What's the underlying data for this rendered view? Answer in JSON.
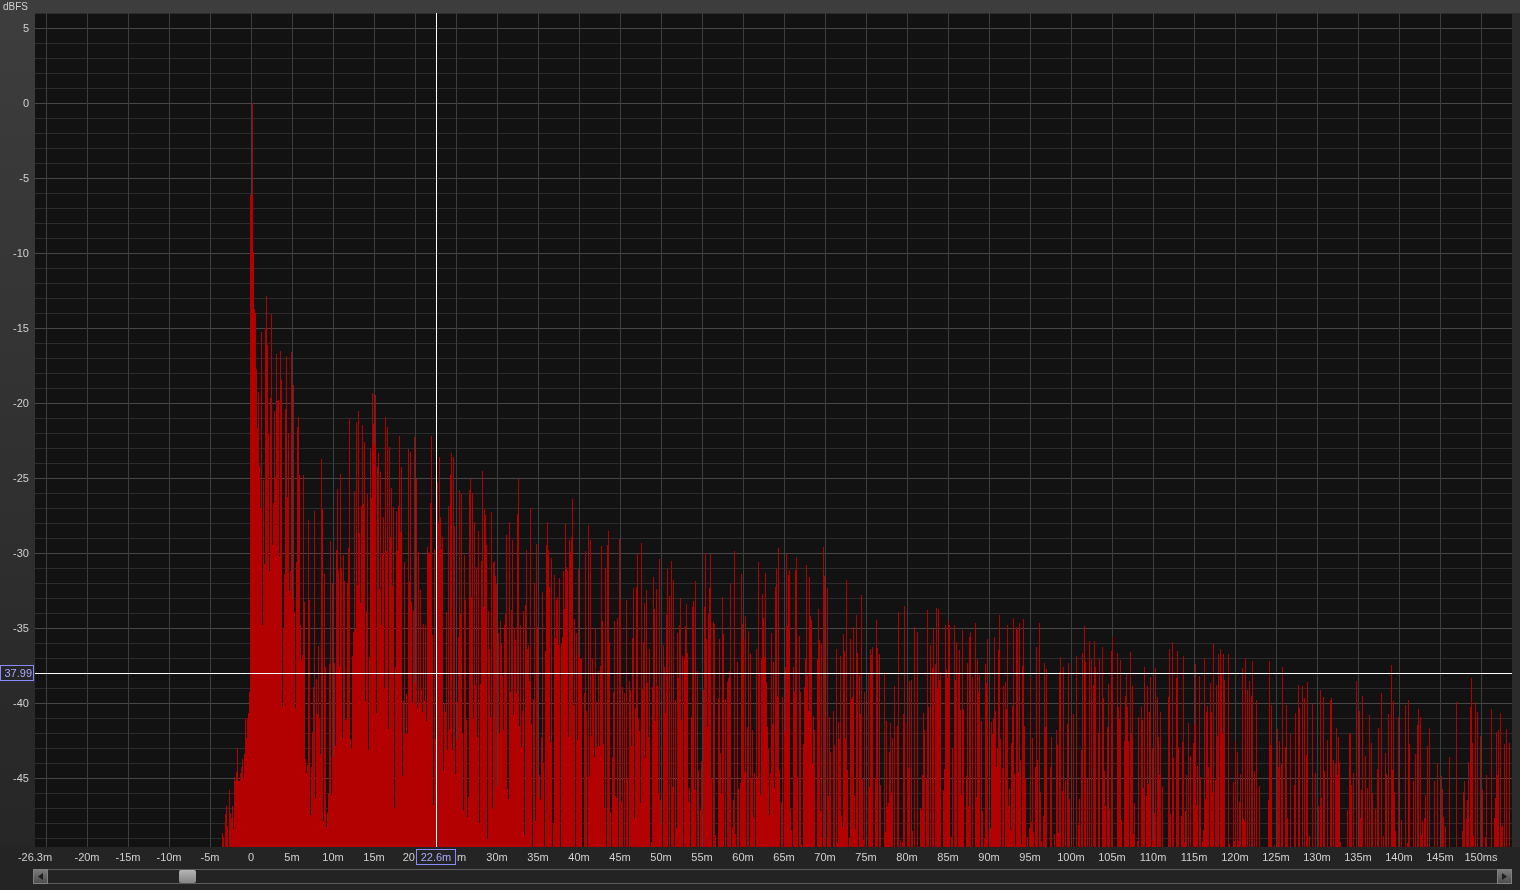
{
  "y_axis": {
    "unit": "dBFS",
    "ticks": [
      "5",
      "0",
      "-5",
      "-10",
      "-15",
      "-20",
      "-25",
      "-30",
      "-35",
      "-40",
      "-45"
    ]
  },
  "x_axis": {
    "ticks": [
      "-26.3m",
      "-20m",
      "-15m",
      "-10m",
      "-5m",
      "0",
      "5m",
      "10m",
      "15m",
      "20",
      "m",
      "30m",
      "35m",
      "40m",
      "45m",
      "50m",
      "55m",
      "60m",
      "65m",
      "70m",
      "75m",
      "80m",
      "85m",
      "90m",
      "95m",
      "100m",
      "105m",
      "110m",
      "115m",
      "120m",
      "125m",
      "130m",
      "135m",
      "140m",
      "145m",
      "150ms"
    ]
  },
  "cursor": {
    "time_readout": "22.6m",
    "level_readout": "37.99"
  }
}
